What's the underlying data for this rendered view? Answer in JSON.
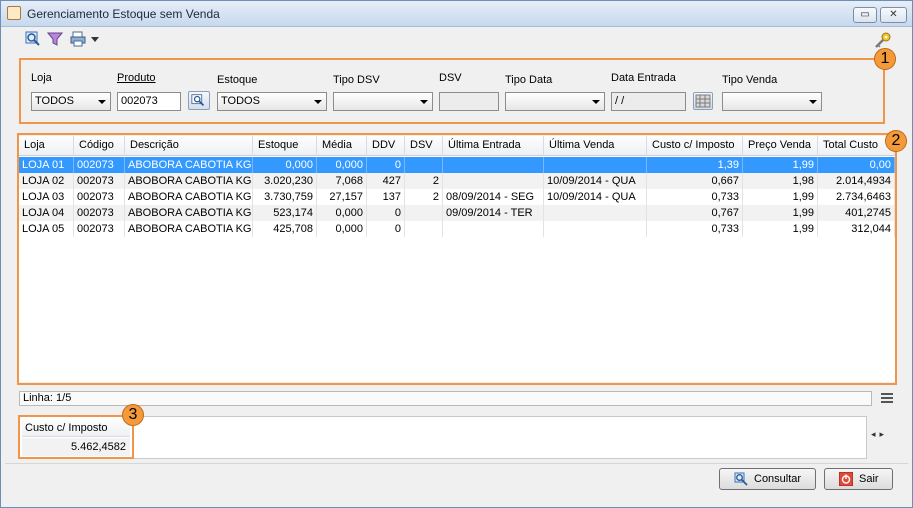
{
  "window": {
    "title": "Gerenciamento Estoque sem Venda"
  },
  "icons": {
    "app": "java-app-icon",
    "toolbar": [
      "search-icon",
      "filter-icon",
      "print-icon"
    ],
    "settings": "key-icon"
  },
  "badges": [
    "1",
    "2",
    "3"
  ],
  "filters": {
    "loja": {
      "label": "Loja",
      "value": "TODOS"
    },
    "produto": {
      "label": "Produto",
      "value": "002073"
    },
    "estoque": {
      "label": "Estoque",
      "value": "TODOS"
    },
    "tipo_dsv": {
      "label": "Tipo DSV",
      "value": ""
    },
    "dsv": {
      "label": "DSV",
      "value": ""
    },
    "tipo_data": {
      "label": "Tipo Data",
      "value": ""
    },
    "data_entrada": {
      "label": "Data Entrada",
      "value": " / /"
    },
    "tipo_venda": {
      "label": "Tipo Venda",
      "value": ""
    }
  },
  "table": {
    "columns": [
      "Loja",
      "Código",
      "Descrição",
      "Estoque",
      "Média",
      "DDV",
      "DSV",
      "Última Entrada",
      "Última Venda",
      "Custo c/ Imposto",
      "Preço Venda",
      "Total Custo"
    ],
    "rows": [
      [
        "LOJA 01",
        "002073",
        "ABOBORA CABOTIA KG",
        "0,000",
        "0,000",
        "0",
        "",
        "",
        "",
        "1,39",
        "1,99",
        "0,00"
      ],
      [
        "LOJA 02",
        "002073",
        "ABOBORA CABOTIA KG",
        "3.020,230",
        "7,068",
        "427",
        "2",
        "",
        "10/09/2014 - QUA",
        "0,667",
        "1,98",
        "2.014,4934"
      ],
      [
        "LOJA 03",
        "002073",
        "ABOBORA CABOTIA KG",
        "3.730,759",
        "27,157",
        "137",
        "2",
        "08/09/2014 - SEG",
        "10/09/2014 - QUA",
        "0,733",
        "1,99",
        "2.734,6463"
      ],
      [
        "LOJA 04",
        "002073",
        "ABOBORA CABOTIA KG",
        "523,174",
        "0,000",
        "0",
        "",
        "09/09/2014 - TER",
        "",
        "0,767",
        "1,99",
        "401,2745"
      ],
      [
        "LOJA 05",
        "002073",
        "ABOBORA CABOTIA KG",
        "425,708",
        "0,000",
        "0",
        "",
        "",
        "",
        "0,733",
        "1,99",
        "312,044"
      ]
    ],
    "selected_row": 0
  },
  "status": {
    "text": "Linha: 1/5"
  },
  "totals": {
    "label": "Custo c/ Imposto",
    "value": "5.462,4582"
  },
  "buttons": {
    "consultar": "Consultar",
    "sair": "Sair"
  }
}
